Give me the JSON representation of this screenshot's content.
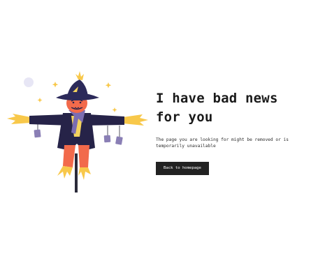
{
  "heading": "I have bad news for you",
  "description": "The page you are looking for might be removed or is temporarily unavailable",
  "button": {
    "label": "Back to homepage"
  },
  "illustration": {
    "icon": "scarecrow-icon",
    "colors": {
      "hat": "#2c2a5a",
      "coat": "#262348",
      "face": "#f26a4b",
      "straw": "#f8c84a",
      "shirt": "#f4d35e",
      "pole": "#2b2b3a",
      "tag": "#8a7fb5",
      "moon": "#e7e6f5"
    }
  },
  "colors": {
    "background": "#ffffff",
    "text": "#1b1b1b",
    "button_bg": "#222222",
    "button_text": "#ffffff"
  }
}
